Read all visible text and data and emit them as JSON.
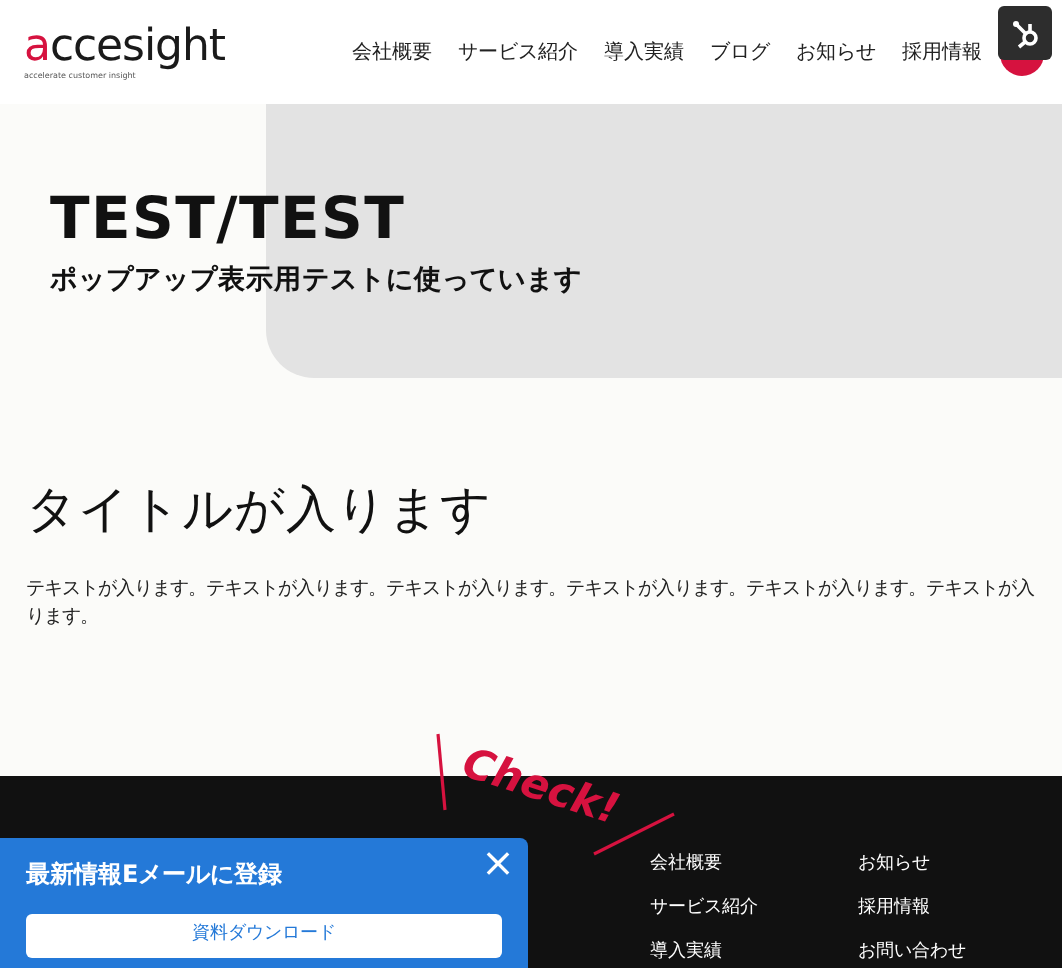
{
  "header": {
    "logo": {
      "word": "accesight",
      "tagline": "accelerate customer insight"
    },
    "nav": [
      "会社概要",
      "サービス紹介",
      "導入実績",
      "ブログ",
      "お知らせ",
      "採用情報"
    ]
  },
  "hero": {
    "title": "TEST/TEST",
    "subtitle": "ポップアップ表示用テストに使っています"
  },
  "section": {
    "title": "タイトルが入ります",
    "body": "テキストが入ります。テキストが入ります。テキストが入ります。テキストが入ります。テキストが入ります。テキストが入ります。"
  },
  "check_badge": "Check!",
  "footer": {
    "links": [
      [
        "会社概要",
        "サービス紹介",
        "導入実績"
      ],
      [
        "お知らせ",
        "採用情報",
        "お問い合わせ"
      ]
    ]
  },
  "popup": {
    "title": "最新情報Eメールに登録",
    "button": "資料ダウンロード",
    "close": "×"
  }
}
